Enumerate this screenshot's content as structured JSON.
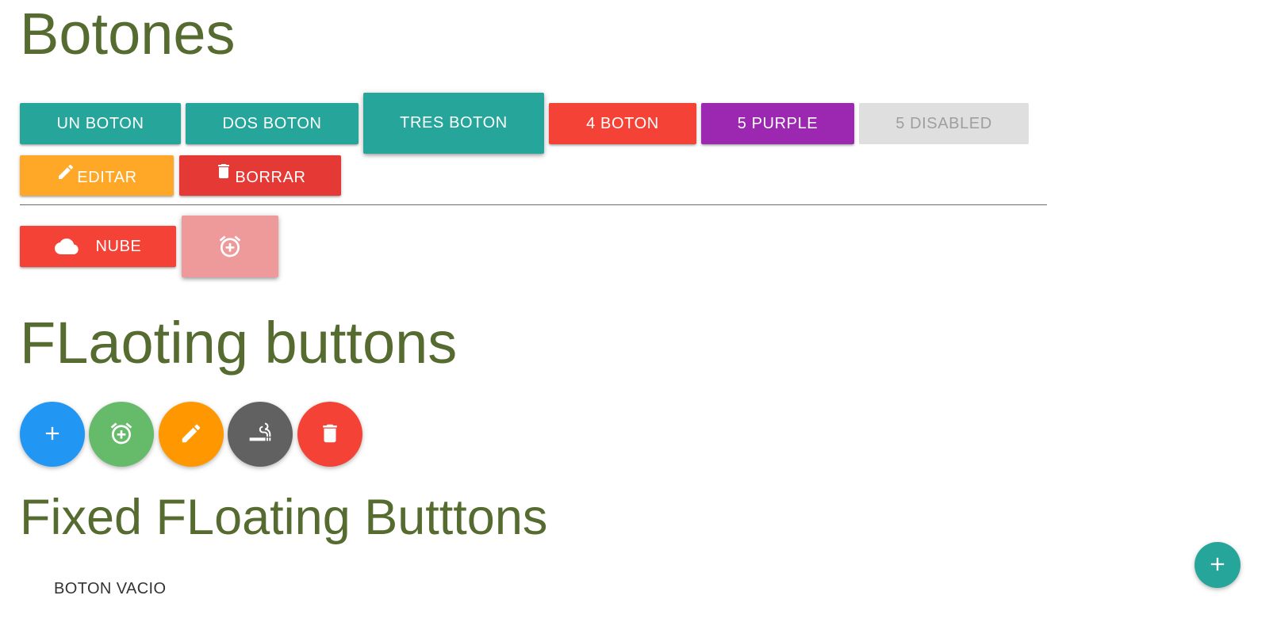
{
  "headings": {
    "botones": "Botones",
    "floating": "FLaoting buttons",
    "fixed": "Fixed FLoating Butttons"
  },
  "buttons": {
    "un_boton": "UN BOTON",
    "dos_boton": "DOS BOTON",
    "tres_boton": "TRES BOTON",
    "cuatro_boton": "4 BOTON",
    "cinco_purple": "5 PURPLE",
    "cinco_disabled": "5 DISABLED",
    "editar": "EDITAR",
    "borrar": "BORRAR",
    "nube": "NUBE",
    "boton_vacio": "BOTON VACIO"
  },
  "icons": {
    "editar": "pencil-icon",
    "borrar": "trash-icon",
    "nube": "cloud-icon",
    "alarm_button": "alarm-add-icon",
    "fab_add": "plus-icon",
    "fab_alarm": "alarm-add-icon",
    "fab_edit": "pencil-icon",
    "fab_smoking": "smoking-icon",
    "fab_delete": "trash-icon",
    "fixed_fab": "plus-icon"
  },
  "colors": {
    "heading": "#556b2f",
    "teal": "#26a69a",
    "red": "#f44336",
    "red_dark": "#e53935",
    "purple": "#9c27b0",
    "disabled_bg": "#dfdfdf",
    "disabled_text": "#9f9f9f",
    "amber": "#ffa726",
    "red_light": "#ef9a9a",
    "blue": "#2196f3",
    "green": "#66bb6a",
    "orange": "#ff9800",
    "grey_dark": "#616161"
  }
}
